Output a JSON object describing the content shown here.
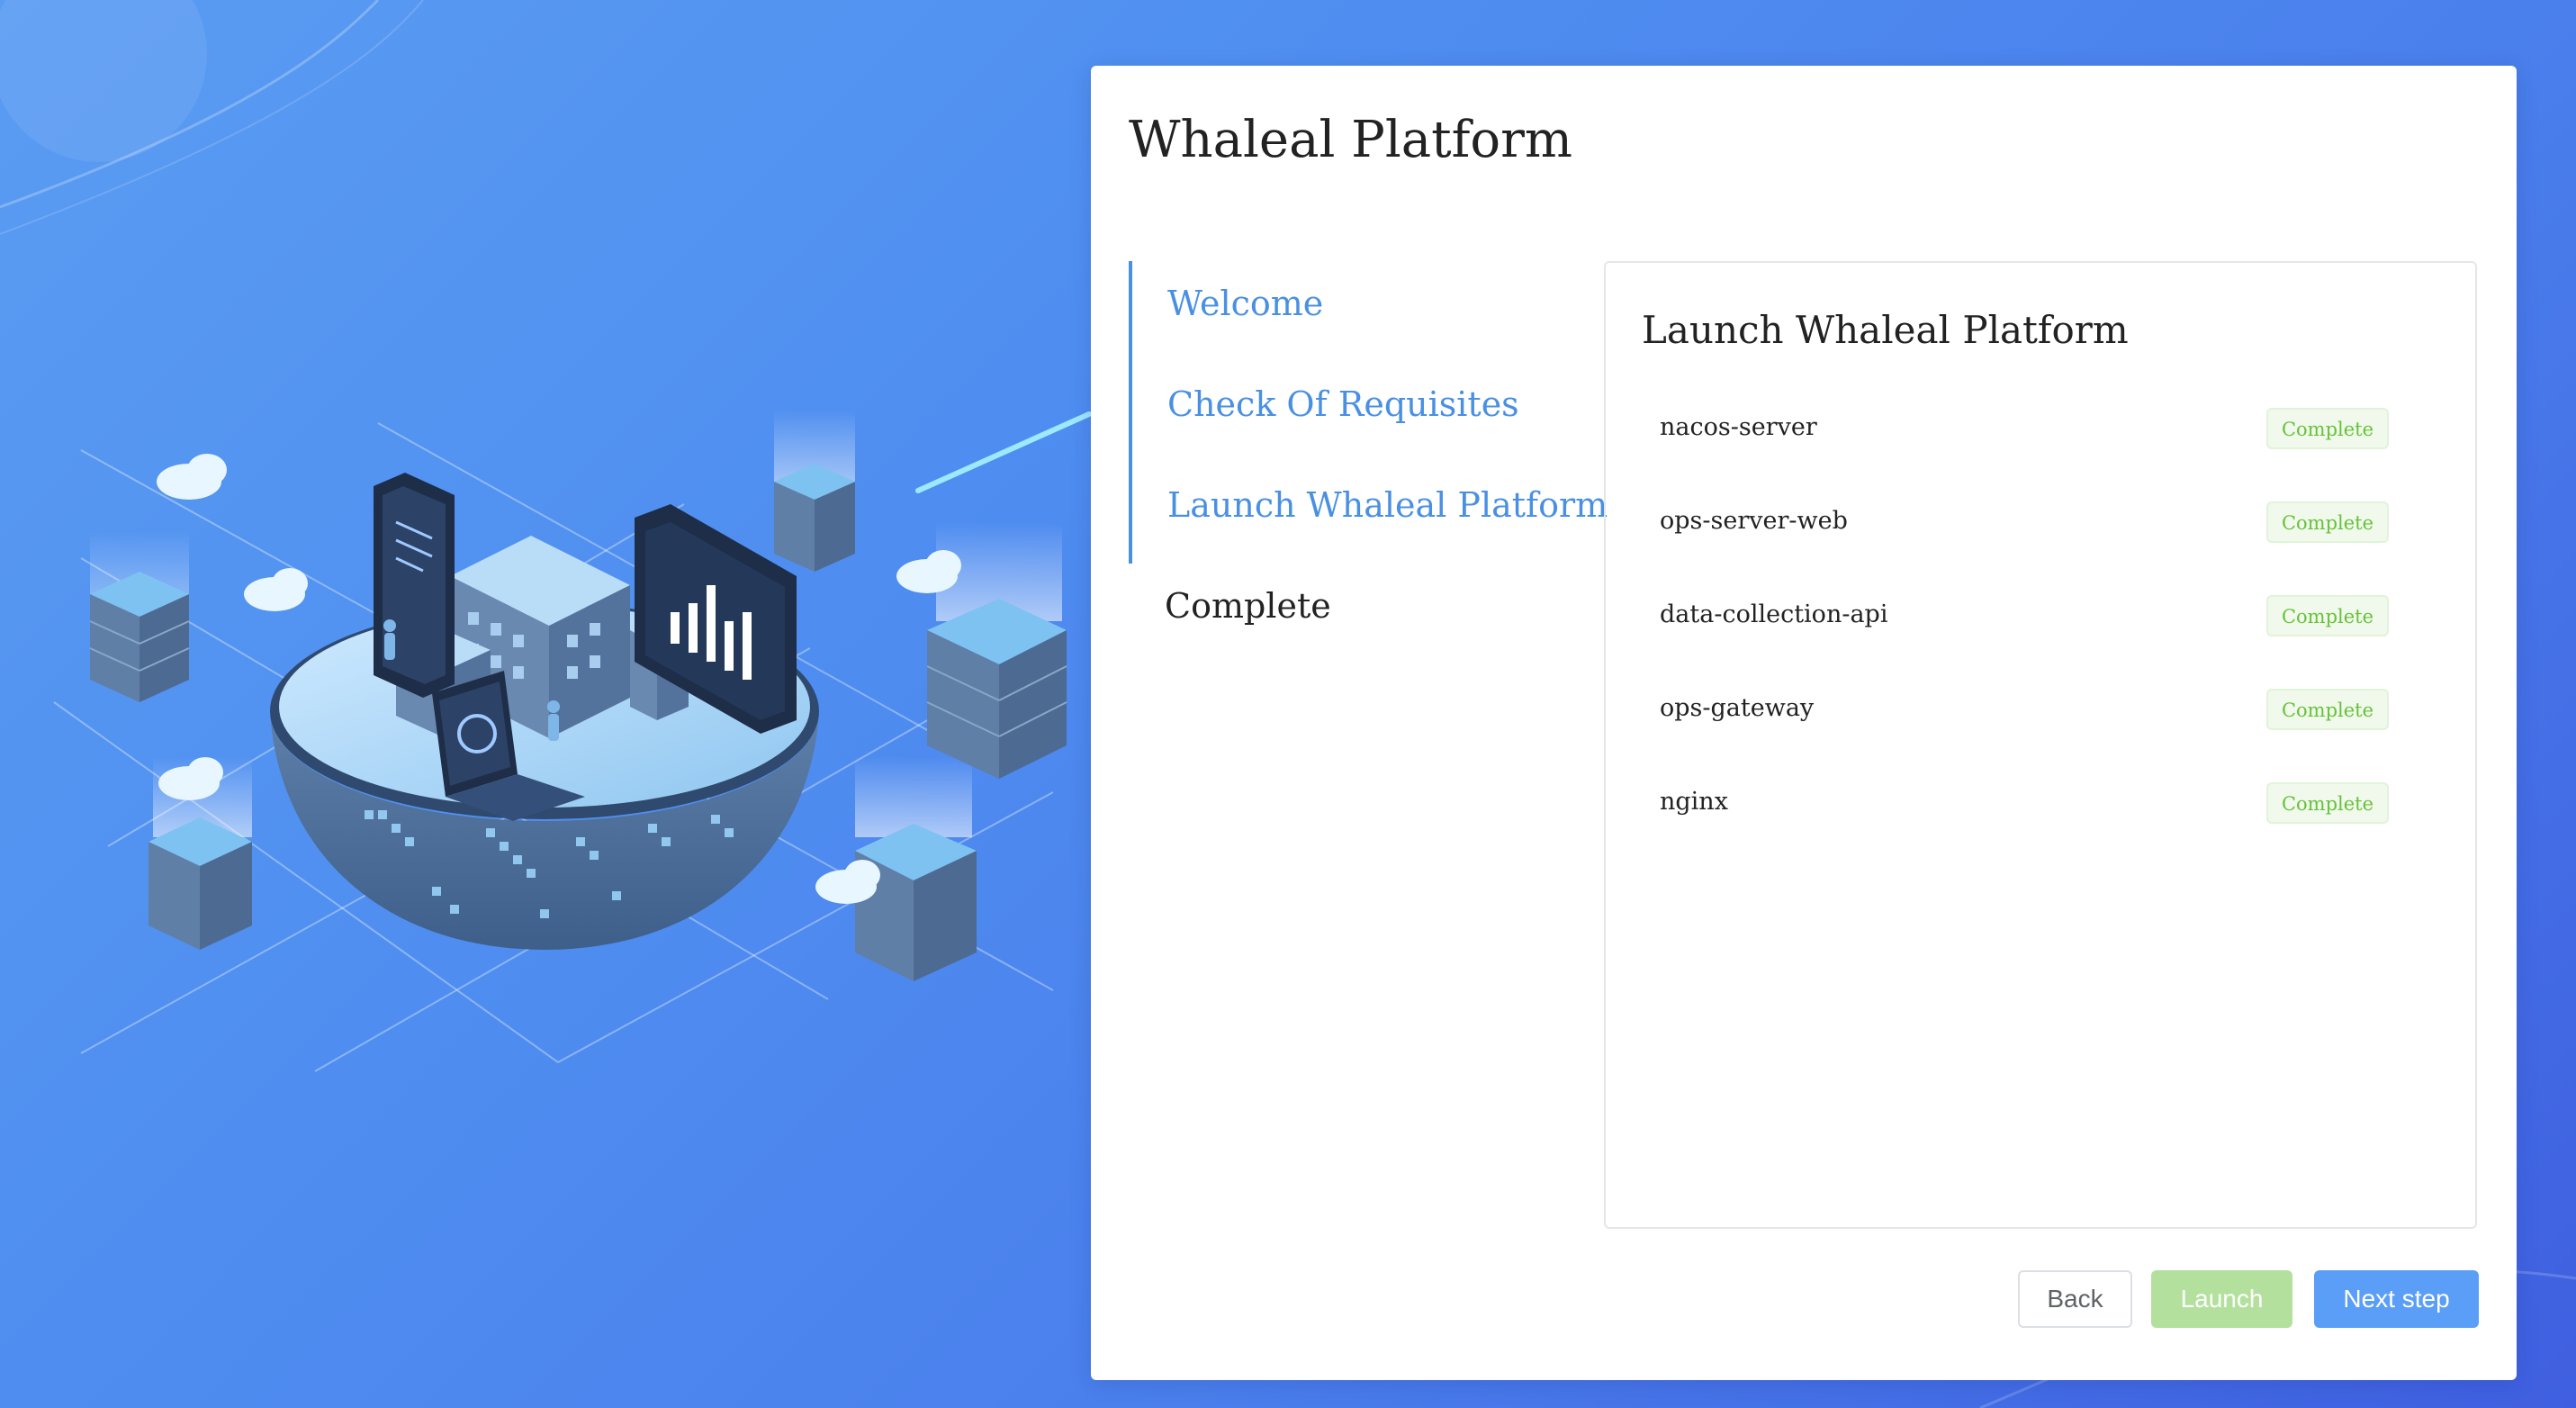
{
  "app": {
    "title": "Whaleal Platform"
  },
  "steps": [
    {
      "label": "Welcome",
      "state": "done"
    },
    {
      "label": "Check Of Requisites",
      "state": "done"
    },
    {
      "label": "Launch Whaleal Platform",
      "state": "done"
    },
    {
      "label": "Complete",
      "state": "pending"
    }
  ],
  "panel": {
    "title": "Launch Whaleal Platform",
    "services": [
      {
        "name": "nacos-server",
        "status": "Complete"
      },
      {
        "name": "ops-server-web",
        "status": "Complete"
      },
      {
        "name": "data-collection-api",
        "status": "Complete"
      },
      {
        "name": "ops-gateway",
        "status": "Complete"
      },
      {
        "name": "nginx",
        "status": "Complete"
      }
    ]
  },
  "buttons": {
    "back": "Back",
    "launch": "Launch",
    "next": "Next step"
  },
  "colors": {
    "accent": "#4a90e2",
    "success": "#67c23a",
    "success_bg": "#f0f9eb",
    "primary_button": "#5a9ef7",
    "disabled_success_button": "#b3e19d"
  },
  "illustration": {
    "name": "isometric-data-center-illustration"
  }
}
